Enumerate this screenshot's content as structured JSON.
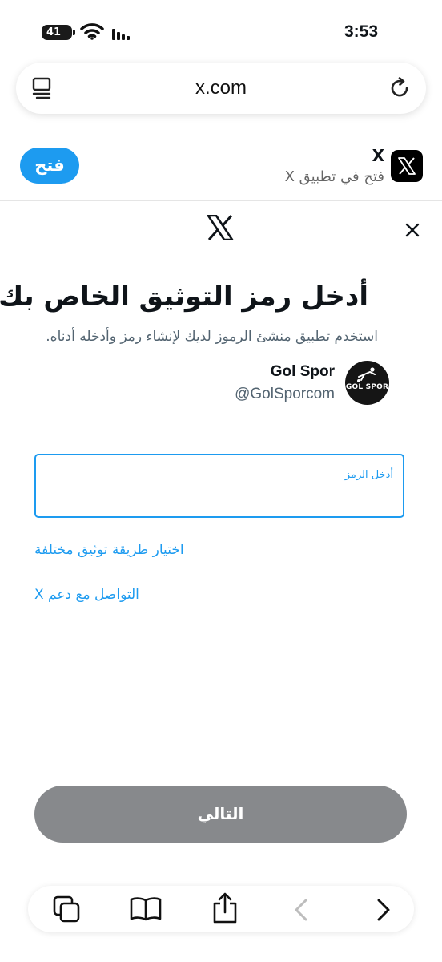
{
  "status_bar": {
    "battery": "41",
    "time": "3:53"
  },
  "browser": {
    "url": "x.com",
    "icons": [
      "reader-icon",
      "reload-icon"
    ]
  },
  "smart_banner": {
    "app_name": "X",
    "subtitle": "فتح في تطبيق X",
    "open_label": "فتح"
  },
  "modal": {
    "title": "أدخل رمز التوثيق الخاص بك",
    "subtitle": "استخدم تطبيق منشئ الرموز لديك لإنشاء رمز وأدخله أدناه.",
    "account": {
      "name": "Gol Spor",
      "handle": "@GolSporcom",
      "avatar_text": "GOL SPOR"
    },
    "code_field": {
      "label": "أدخل الرمز",
      "value": ""
    },
    "links": {
      "different_method": "اختيار طريقة توثيق مختلفة",
      "contact_support": "التواصل مع دعم X"
    },
    "next_label": "التالي"
  },
  "colors": {
    "accent": "#1d9bf0",
    "button_disabled": "#87898c",
    "text_primary": "#0f1419",
    "text_secondary": "#536471"
  },
  "toolbar": {
    "icons": [
      "tabs-icon",
      "bookmarks-icon",
      "share-icon",
      "back-icon",
      "forward-icon"
    ]
  }
}
